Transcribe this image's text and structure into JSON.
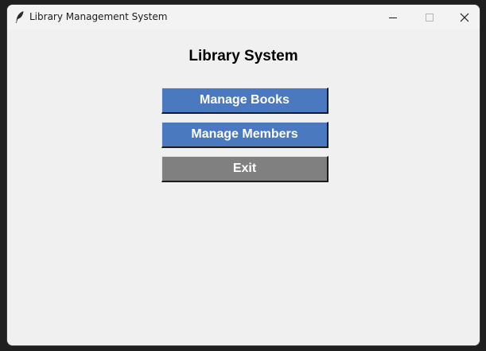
{
  "window": {
    "title": "Library Management System",
    "app_icon": "feather-icon",
    "controls": [
      "minimize-icon",
      "maximize-icon",
      "close-icon"
    ]
  },
  "main": {
    "heading": "Library System",
    "buttons": [
      {
        "label": "Manage Books",
        "color": "#4a79bf"
      },
      {
        "label": "Manage Members",
        "color": "#4a79bf"
      },
      {
        "label": "Exit",
        "color": "#808080"
      }
    ]
  }
}
